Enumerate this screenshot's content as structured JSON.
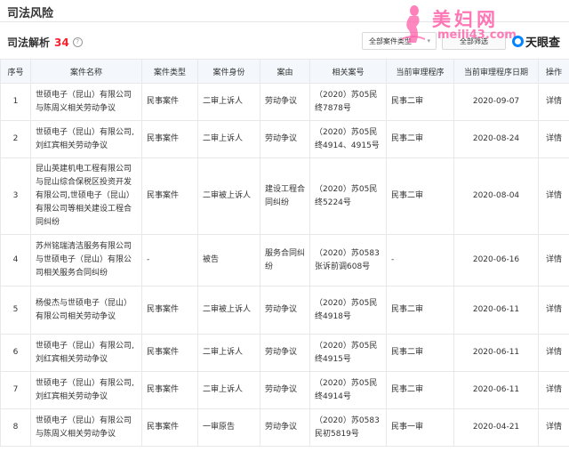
{
  "section_title": "司法风险",
  "sub_header": {
    "label": "司法解析",
    "count": "34",
    "help": "?"
  },
  "filter": {
    "label": "全部案件类型",
    "chevron": "▾",
    "search_label": "全部筛选"
  },
  "watermark": {
    "text": "美妇网",
    "url": "meili43.com"
  },
  "brand": {
    "name": "天眼查"
  },
  "table": {
    "headers": [
      "序号",
      "案件名称",
      "案件类型",
      "案件身份",
      "案由",
      "相关案号",
      "当前审理程序",
      "当前审理程序日期",
      "操作"
    ],
    "rows": [
      {
        "index": "1",
        "name": "世硕电子（昆山）有限公司与陈周义相关劳动争议",
        "type": "民事案件",
        "role": "二审上诉人",
        "cause": "劳动争议",
        "case_no": "（2020）苏05民终7878号",
        "stage": "民事二审",
        "date": "2020-09-07",
        "action": "详情"
      },
      {
        "index": "2",
        "name": "世硕电子（昆山）有限公司,刘红宾相关劳动争议",
        "type": "民事案件",
        "role": "二审上诉人",
        "cause": "劳动争议",
        "case_no": "（2020）苏05民终4914、4915号",
        "stage": "民事二审",
        "date": "2020-08-24",
        "action": "详情"
      },
      {
        "index": "3",
        "name": "昆山英建机电工程有限公司与昆山综合保税区投资开发有限公司,世硕电子（昆山）有限公司等相关建设工程合同纠纷",
        "type": "民事案件",
        "role": "二审被上诉人",
        "cause": "建设工程合同纠纷",
        "case_no": "（2020）苏05民终5224号",
        "stage": "民事二审",
        "date": "2020-08-04",
        "action": "详情"
      },
      {
        "index": "4",
        "name": "苏州铭瑞清洁服务有限公司与世硕电子（昆山）有限公司相关服务合同纠纷",
        "type": "-",
        "role": "被告",
        "cause": "服务合同纠纷",
        "case_no": "（2020）苏0583张诉前调608号",
        "stage": "-",
        "date": "2020-06-16",
        "action": "详情"
      },
      {
        "index": "5",
        "name": "杨俊杰与世硕电子（昆山）有限公司相关劳动争议",
        "type": "民事案件",
        "role": "二审被上诉人",
        "cause": "劳动争议",
        "case_no": "（2020）苏05民终4918号",
        "stage": "民事二审",
        "date": "2020-06-11",
        "action": "详情"
      },
      {
        "index": "6",
        "name": "世硕电子（昆山）有限公司,刘红宾相关劳动争议",
        "type": "民事案件",
        "role": "二审上诉人",
        "cause": "劳动争议",
        "case_no": "（2020）苏05民终4915号",
        "stage": "民事二审",
        "date": "2020-06-11",
        "action": "详情"
      },
      {
        "index": "7",
        "name": "世硕电子（昆山）有限公司,刘红宾相关劳动争议",
        "type": "民事案件",
        "role": "二审上诉人",
        "cause": "劳动争议",
        "case_no": "（2020）苏05民终4914号",
        "stage": "民事二审",
        "date": "2020-06-11",
        "action": "详情"
      },
      {
        "index": "8",
        "name": "世硕电子（昆山）有限公司与陈周义相关劳动争议",
        "type": "民事案件",
        "role": "一审原告",
        "cause": "劳动争议",
        "case_no": "（2020）苏0583民初5819号",
        "stage": "民事一审",
        "date": "2020-04-21",
        "action": "详情"
      }
    ]
  }
}
